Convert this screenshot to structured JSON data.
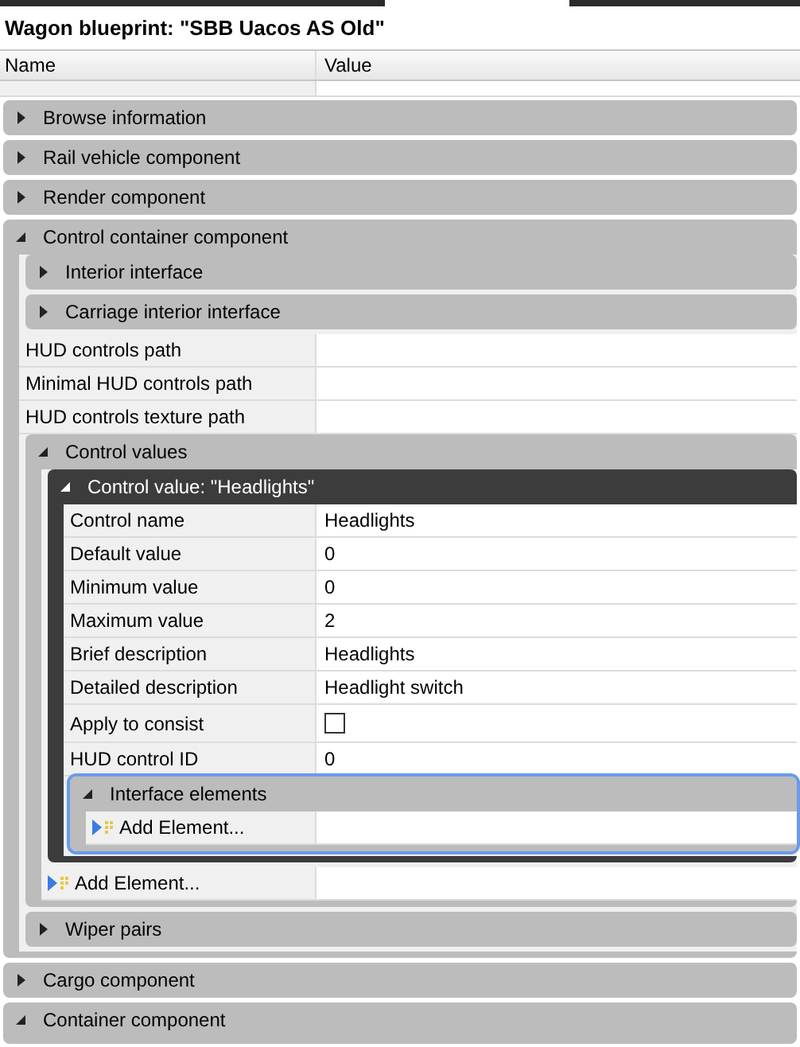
{
  "title": "Wagon blueprint: \"SBB Uacos AS Old\"",
  "columns": [
    "Name",
    "Value"
  ],
  "items": [
    {
      "kind": "group",
      "label": "Browse information",
      "expanded": false,
      "selected": false,
      "dark": false
    },
    {
      "kind": "group",
      "label": "Rail vehicle component",
      "expanded": false,
      "selected": false,
      "dark": false
    },
    {
      "kind": "group",
      "label": "Render component",
      "expanded": false,
      "selected": false,
      "dark": false
    },
    {
      "kind": "group",
      "label": "Control container component",
      "expanded": true,
      "selected": false,
      "dark": false,
      "children": [
        {
          "kind": "group",
          "label": "Interior interface",
          "expanded": false,
          "selected": false,
          "dark": false
        },
        {
          "kind": "group",
          "label": "Carriage interior interface",
          "expanded": false,
          "selected": false,
          "dark": false
        },
        {
          "kind": "property",
          "name": "HUD controls path"
        },
        {
          "kind": "property",
          "name": "Minimal HUD controls path"
        },
        {
          "kind": "property",
          "name": "HUD controls texture path"
        },
        {
          "kind": "group",
          "label": "Control values",
          "expanded": true,
          "selected": false,
          "dark": false,
          "children": [
            {
              "kind": "group",
              "label": "Control value: \"Headlights\"",
              "expanded": true,
              "selected": false,
              "dark": true,
              "children": [
                {
                  "kind": "property",
                  "name": "Control name",
                  "value": "Headlights"
                },
                {
                  "kind": "property",
                  "name": "Default value",
                  "value": "0"
                },
                {
                  "kind": "property",
                  "name": "Minimum value",
                  "value": "0"
                },
                {
                  "kind": "property",
                  "name": "Maximum value",
                  "value": "2"
                },
                {
                  "kind": "property",
                  "name": "Brief description",
                  "value": "Headlights"
                },
                {
                  "kind": "property",
                  "name": "Detailed description",
                  "value": "Headlight switch"
                },
                {
                  "kind": "checkbox",
                  "name": "Apply to consist",
                  "checked": false
                },
                {
                  "kind": "property",
                  "name": "HUD control ID",
                  "value": "0"
                },
                {
                  "kind": "group",
                  "label": "Interface elements",
                  "expanded": true,
                  "selected": true,
                  "dark": false,
                  "children": [
                    {
                      "kind": "add",
                      "label": "Add Element..."
                    }
                  ]
                }
              ]
            },
            {
              "kind": "add",
              "label": "Add Element..."
            }
          ]
        },
        {
          "kind": "group",
          "label": "Wiper pairs",
          "expanded": false,
          "selected": false,
          "dark": false
        }
      ]
    },
    {
      "kind": "group",
      "label": "Cargo component",
      "expanded": false,
      "selected": false,
      "dark": false
    },
    {
      "kind": "group",
      "label": "Container component",
      "expanded": true,
      "selected": false,
      "dark": false
    }
  ]
}
